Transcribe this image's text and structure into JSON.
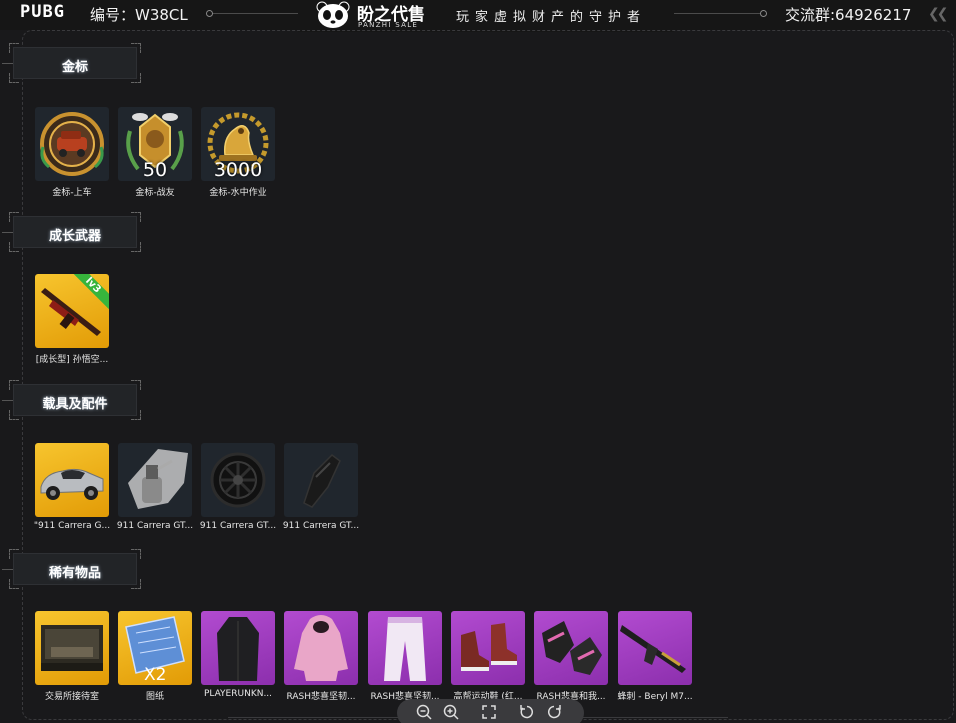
{
  "header": {
    "game_logo": "PUBG",
    "serial_label": "编号：W38CL",
    "brand_name": "盼之代售",
    "brand_sub": "PANZHI SALE",
    "slogan": "玩家虚拟财产的守护者",
    "group_label": "交流群:64926217"
  },
  "sections": [
    {
      "title": "金标",
      "items": [
        {
          "caption": "金标-上车",
          "badge": ""
        },
        {
          "caption": "金标-战友",
          "badge": "50"
        },
        {
          "caption": "金标-水中作业",
          "badge": "3000"
        }
      ]
    },
    {
      "title": "成长武器",
      "items": [
        {
          "caption": "[成长型] 孙悟空...",
          "tag": "lv3"
        }
      ]
    },
    {
      "title": "载具及配件",
      "items": [
        {
          "caption": "\"911 Carrera G..."
        },
        {
          "caption": "911 Carrera GT..."
        },
        {
          "caption": "911 Carrera GT..."
        },
        {
          "caption": "911 Carrera GT..."
        }
      ]
    },
    {
      "title": "稀有物品",
      "items": [
        {
          "caption": "交易所接待室"
        },
        {
          "caption": "图纸",
          "badge": "X2"
        },
        {
          "caption": "PLAYERUNKN..."
        },
        {
          "caption": "RASH悲喜坚韧..."
        },
        {
          "caption": "RASH悲喜坚韧..."
        },
        {
          "caption": "高帮运动鞋 (红..."
        },
        {
          "caption": "RASH悲喜和我..."
        },
        {
          "caption": "蜂刺 - Beryl M7..."
        }
      ]
    }
  ],
  "toolbar": {
    "zoom_out_icon": "zoom-out-icon",
    "zoom_in_icon": "zoom-in-icon",
    "fullscreen_icon": "fullscreen-icon",
    "rotate_left_icon": "rotate-left-icon",
    "rotate_right_icon": "rotate-right-icon"
  },
  "colors": {
    "background": "#19191b",
    "gold_tile": "#f2b41c",
    "purple_tile": "#a03fc2",
    "dark_tile": "#20262d",
    "level_tag": "#37b43c"
  }
}
